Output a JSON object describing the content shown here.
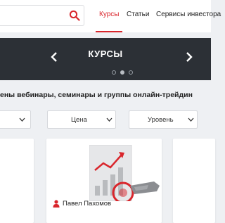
{
  "header": {
    "nav": [
      {
        "label": "Курсы",
        "active": true
      },
      {
        "label": "Статьи",
        "active": false
      },
      {
        "label": "Сервисы инвестора",
        "active": false
      }
    ],
    "accent_color": "#d9262c"
  },
  "banner": {
    "title": "КУРСЫ",
    "prev_icon": "chevron-left-icon",
    "next_icon": "chevron-right-icon",
    "slides_total": 3,
    "slide_active_index": 2,
    "background_color": "#2c3036"
  },
  "main": {
    "subtitle": "ены вебинары, семинары и группы онлайн-трейдин",
    "filters": [
      {
        "label": ""
      },
      {
        "label": "Цена"
      },
      {
        "label": "Уровень"
      }
    ]
  },
  "cards": [
    {
      "author": ""
    },
    {
      "author": "Павел Пахомов",
      "image_icon": "growth-chart-icon"
    }
  ]
}
